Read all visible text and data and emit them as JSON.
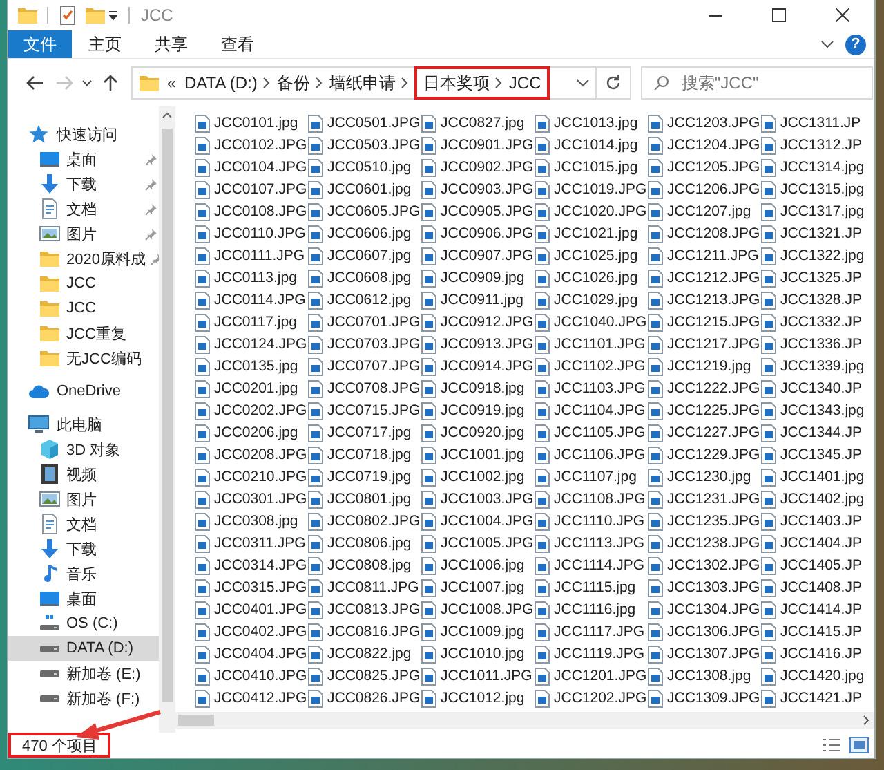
{
  "window": {
    "title": "JCC"
  },
  "ribbon": {
    "tabs": [
      {
        "label": "文件",
        "kind": "file"
      },
      {
        "label": "主页",
        "kind": "tab"
      },
      {
        "label": "共享",
        "kind": "tab"
      },
      {
        "label": "查看",
        "kind": "tab"
      }
    ],
    "help": "?"
  },
  "address_bar": {
    "nav_buttons": [
      {
        "kind": "back",
        "disabled": false
      },
      {
        "kind": "forward",
        "disabled": true
      },
      {
        "kind": "recent",
        "disabled": false
      },
      {
        "kind": "up",
        "disabled": false
      }
    ],
    "overflow": "«",
    "crumbs": [
      {
        "label": "DATA (D:)",
        "highlighted": false
      },
      {
        "label": "备份",
        "highlighted": false
      },
      {
        "label": "墙纸申请",
        "highlighted": false
      },
      {
        "label": "日本奖项",
        "highlighted": true
      },
      {
        "label": "JCC",
        "highlighted": true
      }
    ]
  },
  "search": {
    "placeholder": "搜索\"JCC\""
  },
  "sidebar": {
    "items": [
      {
        "label": "快速访问",
        "kind": "star",
        "selected": false,
        "children": [
          {
            "label": "桌面",
            "kind": "desktop",
            "pinned": true,
            "selected": false
          },
          {
            "label": "下载",
            "kind": "download",
            "pinned": true,
            "selected": false
          },
          {
            "label": "文档",
            "kind": "document",
            "pinned": true,
            "selected": false
          },
          {
            "label": "图片",
            "kind": "picture",
            "pinned": true,
            "selected": false
          },
          {
            "label": "2020原料成",
            "kind": "folder",
            "pinned": true,
            "selected": false
          },
          {
            "label": "JCC",
            "kind": "folder",
            "pinned": false,
            "selected": false
          },
          {
            "label": "JCC",
            "kind": "folder",
            "pinned": false,
            "selected": false
          },
          {
            "label": "JCC重复",
            "kind": "folder",
            "pinned": false,
            "selected": false
          },
          {
            "label": "无JCC编码",
            "kind": "folder",
            "pinned": false,
            "selected": false
          }
        ]
      },
      {
        "label": "OneDrive",
        "kind": "cloud",
        "selected": false
      },
      {
        "label": "此电脑",
        "kind": "computer",
        "selected": false,
        "children": [
          {
            "label": "3D 对象",
            "kind": "cube",
            "selected": false
          },
          {
            "label": "视频",
            "kind": "video",
            "selected": false
          },
          {
            "label": "图片",
            "kind": "picture",
            "selected": false
          },
          {
            "label": "文档",
            "kind": "document",
            "selected": false
          },
          {
            "label": "下载",
            "kind": "download",
            "selected": false
          },
          {
            "label": "音乐",
            "kind": "music",
            "selected": false
          },
          {
            "label": "桌面",
            "kind": "desktop",
            "selected": false
          },
          {
            "label": "OS (C:)",
            "kind": "system-drive",
            "selected": false
          },
          {
            "label": "DATA (D:)",
            "kind": "drive",
            "selected": true
          },
          {
            "label": "新加卷 (E:)",
            "kind": "drive",
            "selected": false
          },
          {
            "label": "新加卷 (F:)",
            "kind": "drive",
            "selected": false
          }
        ]
      }
    ]
  },
  "files": {
    "columns": [
      [
        "JCC0101.jpg",
        "JCC0102.JPG",
        "JCC0104.JPG",
        "JCC0107.JPG",
        "JCC0108.JPG",
        "JCC0110.JPG",
        "JCC0111.JPG",
        "JCC0113.jpg",
        "JCC0114.JPG",
        "JCC0117.jpg",
        "JCC0124.JPG",
        "JCC0135.jpg",
        "JCC0201.jpg",
        "JCC0202.JPG",
        "JCC0206.jpg",
        "JCC0208.JPG",
        "JCC0210.JPG",
        "JCC0301.JPG",
        "JCC0308.jpg",
        "JCC0311.JPG",
        "JCC0314.JPG",
        "JCC0315.JPG",
        "JCC0401.JPG",
        "JCC0402.JPG",
        "JCC0404.JPG",
        "JCC0410.JPG",
        "JCC0412.JPG"
      ],
      [
        "JCC0501.JPG",
        "JCC0503.JPG",
        "JCC0510.jpg",
        "JCC0601.jpg",
        "JCC0605.JPG",
        "JCC0606.jpg",
        "JCC0607.jpg",
        "JCC0608.jpg",
        "JCC0612.jpg",
        "JCC0701.JPG",
        "JCC0703.JPG",
        "JCC0707.JPG",
        "JCC0708.JPG",
        "JCC0715.JPG",
        "JCC0717.jpg",
        "JCC0718.jpg",
        "JCC0719.jpg",
        "JCC0801.jpg",
        "JCC0802.JPG",
        "JCC0806.jpg",
        "JCC0808.jpg",
        "JCC0811.JPG",
        "JCC0813.JPG",
        "JCC0816.JPG",
        "JCC0822.jpg",
        "JCC0825.JPG",
        "JCC0826.JPG"
      ],
      [
        "JCC0827.jpg",
        "JCC0901.JPG",
        "JCC0902.JPG",
        "JCC0903.JPG",
        "JCC0905.JPG",
        "JCC0906.JPG",
        "JCC0907.JPG",
        "JCC0909.jpg",
        "JCC0911.jpg",
        "JCC0912.JPG",
        "JCC0913.JPG",
        "JCC0914.JPG",
        "JCC0918.jpg",
        "JCC0919.jpg",
        "JCC0920.jpg",
        "JCC1001.jpg",
        "JCC1002.jpg",
        "JCC1003.JPG",
        "JCC1004.JPG",
        "JCC1005.JPG",
        "JCC1006.jpg",
        "JCC1007.jpg",
        "JCC1008.JPG",
        "JCC1009.jpg",
        "JCC1010.jpg",
        "JCC1011.JPG",
        "JCC1012.jpg"
      ],
      [
        "JCC1013.jpg",
        "JCC1014.jpg",
        "JCC1015.jpg",
        "JCC1019.JPG",
        "JCC1020.JPG",
        "JCC1021.jpg",
        "JCC1025.jpg",
        "JCC1026.jpg",
        "JCC1029.jpg",
        "JCC1040.JPG",
        "JCC1101.JPG",
        "JCC1102.JPG",
        "JCC1103.JPG",
        "JCC1104.JPG",
        "JCC1105.JPG",
        "JCC1106.JPG",
        "JCC1107.jpg",
        "JCC1108.JPG",
        "JCC1110.JPG",
        "JCC1113.JPG",
        "JCC1114.JPG",
        "JCC1115.jpg",
        "JCC1116.jpg",
        "JCC1117.JPG",
        "JCC1119.JPG",
        "JCC1201.JPG",
        "JCC1202.JPG"
      ],
      [
        "JCC1203.JPG",
        "JCC1204.JPG",
        "JCC1205.JPG",
        "JCC1206.JPG",
        "JCC1207.jpg",
        "JCC1208.JPG",
        "JCC1211.JPG",
        "JCC1212.JPG",
        "JCC1213.JPG",
        "JCC1215.JPG",
        "JCC1217.JPG",
        "JCC1219.jpg",
        "JCC1222.JPG",
        "JCC1225.JPG",
        "JCC1227.JPG",
        "JCC1229.JPG",
        "JCC1230.jpg",
        "JCC1231.JPG",
        "JCC1235.JPG",
        "JCC1238.JPG",
        "JCC1302.JPG",
        "JCC1303.JPG",
        "JCC1304.JPG",
        "JCC1306.JPG",
        "JCC1307.JPG",
        "JCC1308.jpg",
        "JCC1309.JPG"
      ],
      [
        "JCC1311.JP",
        "JCC1312.JP",
        "JCC1314.jpg",
        "JCC1315.jpg",
        "JCC1317.jpg",
        "JCC1321.JP",
        "JCC1322.jpg",
        "JCC1325.JP",
        "JCC1328.JP",
        "JCC1332.JP",
        "JCC1336.JP",
        "JCC1339.jpg",
        "JCC1340.JP",
        "JCC1343.jpg",
        "JCC1344.JP",
        "JCC1345.JP",
        "JCC1401.jpg",
        "JCC1402.jpg",
        "JCC1403.JP",
        "JCC1404.JP",
        "JCC1405.JP",
        "JCC1408.JP",
        "JCC1414.JP",
        "JCC1415.JP",
        "JCC1416.JP",
        "JCC1420.jpg",
        "JCC1421.JP"
      ]
    ]
  },
  "status_bar": {
    "text": "470 个项目",
    "highlighted": true
  }
}
